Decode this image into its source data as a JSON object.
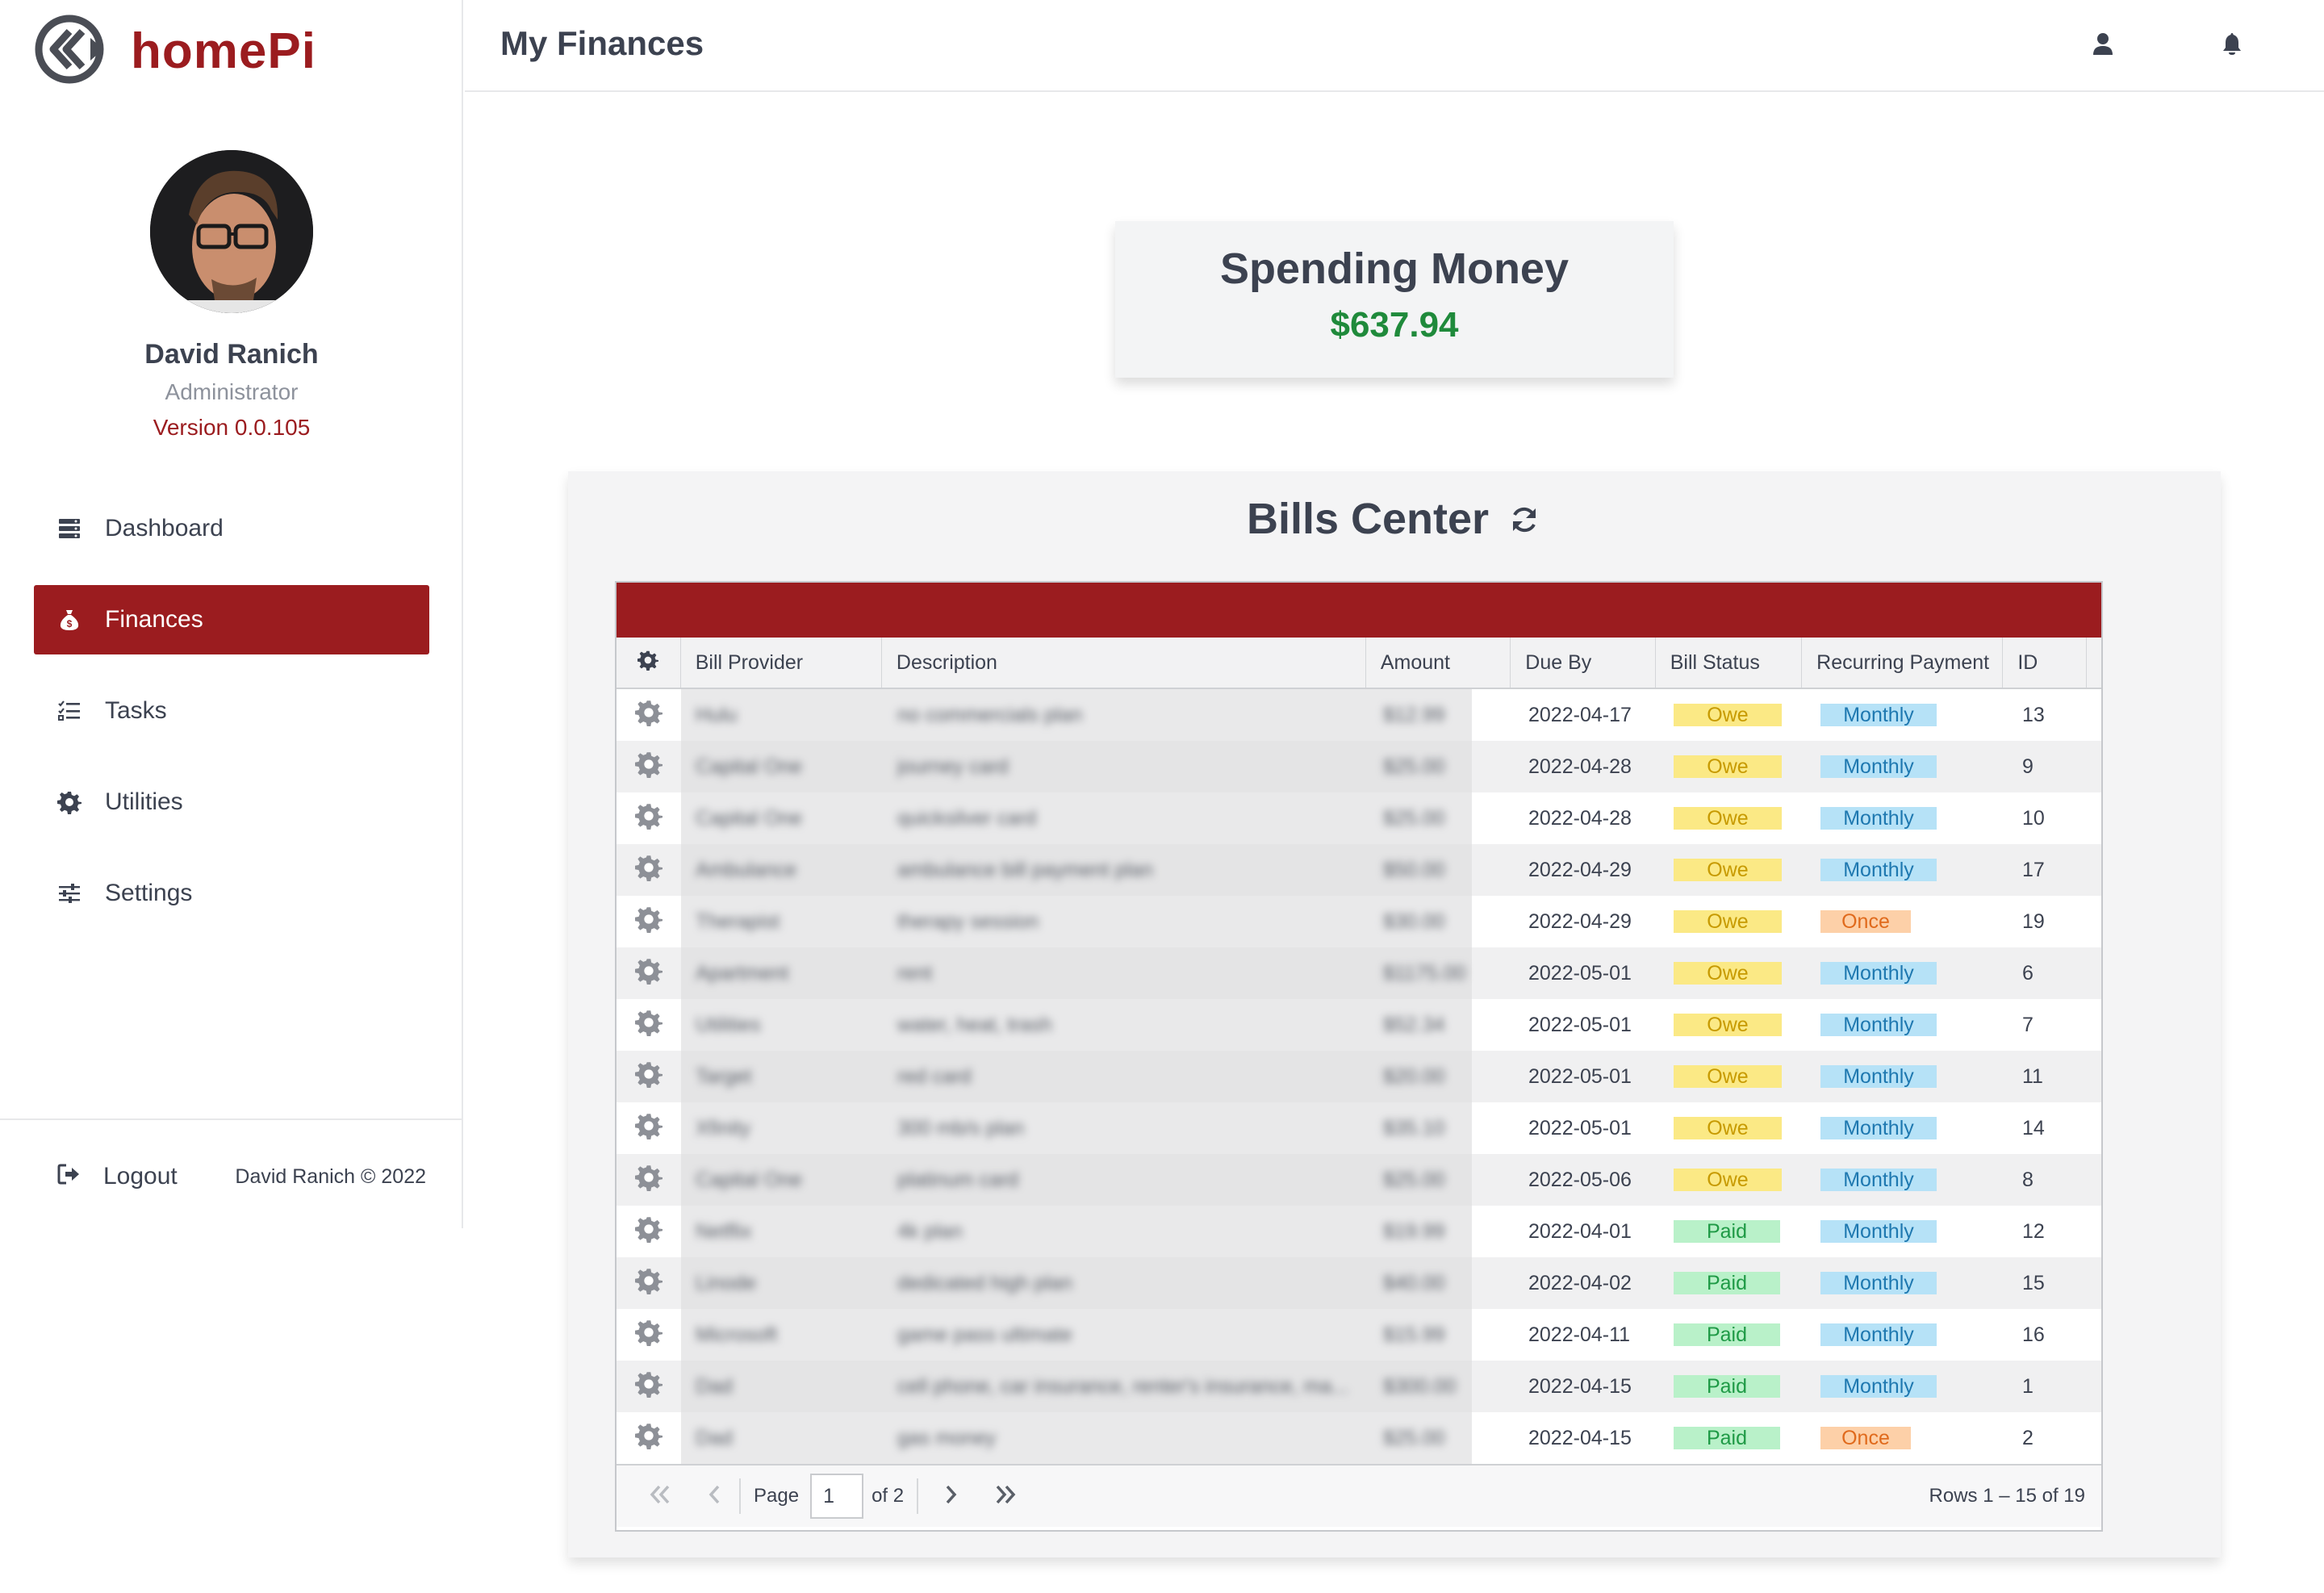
{
  "brand": {
    "name": "homePi"
  },
  "profile": {
    "name": "David Ranich",
    "role": "Administrator",
    "version": "Version 0.0.105"
  },
  "nav": {
    "items": [
      {
        "label": "Dashboard",
        "icon": "server-icon",
        "active": false
      },
      {
        "label": "Finances",
        "icon": "money-bag-icon",
        "active": true
      },
      {
        "label": "Tasks",
        "icon": "task-list-icon",
        "active": false
      },
      {
        "label": "Utilities",
        "icon": "gear-icon",
        "active": false
      },
      {
        "label": "Settings",
        "icon": "sliders-icon",
        "active": false
      }
    ]
  },
  "footer": {
    "logout_label": "Logout",
    "copyright": "David Ranich © 2022"
  },
  "header": {
    "title": "My Finances",
    "icons": [
      "user-icon",
      "bell-icon"
    ]
  },
  "spending": {
    "title": "Spending Money",
    "amount": "$637.94"
  },
  "colors": {
    "brand": "#9b1c1f",
    "money": "#1f8a3b",
    "owe": "#fbe985",
    "paid": "#b9f1c9",
    "monthly": "#b6e2f7",
    "once": "#fdd0a8"
  },
  "bills": {
    "title": "Bills Center",
    "columns": [
      "",
      "Bill Provider",
      "Description",
      "Amount",
      "Due By",
      "Bill Status",
      "Recurring Payment",
      "ID"
    ],
    "rows": [
      {
        "provider": "Hulu",
        "description": "no commercials plan",
        "amount": "$12.99",
        "due": "2022-04-17",
        "status": "Owe",
        "recurring": "Monthly",
        "id": "13"
      },
      {
        "provider": "Capital One",
        "description": "journey card",
        "amount": "$25.00",
        "due": "2022-04-28",
        "status": "Owe",
        "recurring": "Monthly",
        "id": "9"
      },
      {
        "provider": "Capital One",
        "description": "quicksilver card",
        "amount": "$25.00",
        "due": "2022-04-28",
        "status": "Owe",
        "recurring": "Monthly",
        "id": "10"
      },
      {
        "provider": "Ambulance",
        "description": "ambulance bill payment plan",
        "amount": "$50.00",
        "due": "2022-04-29",
        "status": "Owe",
        "recurring": "Monthly",
        "id": "17"
      },
      {
        "provider": "Therapist",
        "description": "therapy session",
        "amount": "$30.00",
        "due": "2022-04-29",
        "status": "Owe",
        "recurring": "Once",
        "id": "19"
      },
      {
        "provider": "Apartment",
        "description": "rent",
        "amount": "$1175.00",
        "due": "2022-05-01",
        "status": "Owe",
        "recurring": "Monthly",
        "id": "6"
      },
      {
        "provider": "Utilities",
        "description": "water, heat, trash",
        "amount": "$52.34",
        "due": "2022-05-01",
        "status": "Owe",
        "recurring": "Monthly",
        "id": "7"
      },
      {
        "provider": "Target",
        "description": "red card",
        "amount": "$20.00",
        "due": "2022-05-01",
        "status": "Owe",
        "recurring": "Monthly",
        "id": "11"
      },
      {
        "provider": "Xfinity",
        "description": "300 mb/s plan",
        "amount": "$35.10",
        "due": "2022-05-01",
        "status": "Owe",
        "recurring": "Monthly",
        "id": "14"
      },
      {
        "provider": "Capital One",
        "description": "platinum card",
        "amount": "$25.00",
        "due": "2022-05-06",
        "status": "Owe",
        "recurring": "Monthly",
        "id": "8"
      },
      {
        "provider": "Netflix",
        "description": "4k plan",
        "amount": "$19.99",
        "due": "2022-04-01",
        "status": "Paid",
        "recurring": "Monthly",
        "id": "12"
      },
      {
        "provider": "Linode",
        "description": "dedicated high plan",
        "amount": "$40.00",
        "due": "2022-04-02",
        "status": "Paid",
        "recurring": "Monthly",
        "id": "15"
      },
      {
        "provider": "Microsoft",
        "description": "game pass ultimate",
        "amount": "$15.99",
        "due": "2022-04-11",
        "status": "Paid",
        "recurring": "Monthly",
        "id": "16"
      },
      {
        "provider": "Dad",
        "description": "cell phone, car insurance, renter's insurance, ma...",
        "amount": "$300.00",
        "due": "2022-04-15",
        "status": "Paid",
        "recurring": "Monthly",
        "id": "1"
      },
      {
        "provider": "Dad",
        "description": "gas money",
        "amount": "$25.00",
        "due": "2022-04-15",
        "status": "Paid",
        "recurring": "Once",
        "id": "2"
      }
    ],
    "pager": {
      "page_label": "Page",
      "page_value": "1",
      "of_label": "of 2",
      "rows_label": "Rows 1 – 15 of 19"
    }
  }
}
